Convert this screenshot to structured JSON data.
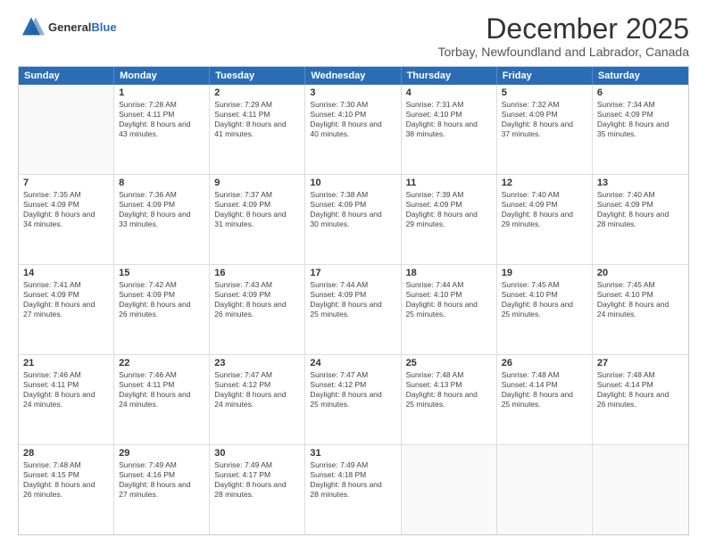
{
  "logo": {
    "line1": "General",
    "line2": "Blue"
  },
  "title": "December 2025",
  "subtitle": "Torbay, Newfoundland and Labrador, Canada",
  "header_days": [
    "Sunday",
    "Monday",
    "Tuesday",
    "Wednesday",
    "Thursday",
    "Friday",
    "Saturday"
  ],
  "weeks": [
    [
      {
        "day": "",
        "sunrise": "",
        "sunset": "",
        "daylight": ""
      },
      {
        "day": "1",
        "sunrise": "Sunrise: 7:28 AM",
        "sunset": "Sunset: 4:11 PM",
        "daylight": "Daylight: 8 hours and 43 minutes."
      },
      {
        "day": "2",
        "sunrise": "Sunrise: 7:29 AM",
        "sunset": "Sunset: 4:11 PM",
        "daylight": "Daylight: 8 hours and 41 minutes."
      },
      {
        "day": "3",
        "sunrise": "Sunrise: 7:30 AM",
        "sunset": "Sunset: 4:10 PM",
        "daylight": "Daylight: 8 hours and 40 minutes."
      },
      {
        "day": "4",
        "sunrise": "Sunrise: 7:31 AM",
        "sunset": "Sunset: 4:10 PM",
        "daylight": "Daylight: 8 hours and 38 minutes."
      },
      {
        "day": "5",
        "sunrise": "Sunrise: 7:32 AM",
        "sunset": "Sunset: 4:09 PM",
        "daylight": "Daylight: 8 hours and 37 minutes."
      },
      {
        "day": "6",
        "sunrise": "Sunrise: 7:34 AM",
        "sunset": "Sunset: 4:09 PM",
        "daylight": "Daylight: 8 hours and 35 minutes."
      }
    ],
    [
      {
        "day": "7",
        "sunrise": "Sunrise: 7:35 AM",
        "sunset": "Sunset: 4:09 PM",
        "daylight": "Daylight: 8 hours and 34 minutes."
      },
      {
        "day": "8",
        "sunrise": "Sunrise: 7:36 AM",
        "sunset": "Sunset: 4:09 PM",
        "daylight": "Daylight: 8 hours and 33 minutes."
      },
      {
        "day": "9",
        "sunrise": "Sunrise: 7:37 AM",
        "sunset": "Sunset: 4:09 PM",
        "daylight": "Daylight: 8 hours and 31 minutes."
      },
      {
        "day": "10",
        "sunrise": "Sunrise: 7:38 AM",
        "sunset": "Sunset: 4:09 PM",
        "daylight": "Daylight: 8 hours and 30 minutes."
      },
      {
        "day": "11",
        "sunrise": "Sunrise: 7:39 AM",
        "sunset": "Sunset: 4:09 PM",
        "daylight": "Daylight: 8 hours and 29 minutes."
      },
      {
        "day": "12",
        "sunrise": "Sunrise: 7:40 AM",
        "sunset": "Sunset: 4:09 PM",
        "daylight": "Daylight: 8 hours and 29 minutes."
      },
      {
        "day": "13",
        "sunrise": "Sunrise: 7:40 AM",
        "sunset": "Sunset: 4:09 PM",
        "daylight": "Daylight: 8 hours and 28 minutes."
      }
    ],
    [
      {
        "day": "14",
        "sunrise": "Sunrise: 7:41 AM",
        "sunset": "Sunset: 4:09 PM",
        "daylight": "Daylight: 8 hours and 27 minutes."
      },
      {
        "day": "15",
        "sunrise": "Sunrise: 7:42 AM",
        "sunset": "Sunset: 4:09 PM",
        "daylight": "Daylight: 8 hours and 26 minutes."
      },
      {
        "day": "16",
        "sunrise": "Sunrise: 7:43 AM",
        "sunset": "Sunset: 4:09 PM",
        "daylight": "Daylight: 8 hours and 26 minutes."
      },
      {
        "day": "17",
        "sunrise": "Sunrise: 7:44 AM",
        "sunset": "Sunset: 4:09 PM",
        "daylight": "Daylight: 8 hours and 25 minutes."
      },
      {
        "day": "18",
        "sunrise": "Sunrise: 7:44 AM",
        "sunset": "Sunset: 4:10 PM",
        "daylight": "Daylight: 8 hours and 25 minutes."
      },
      {
        "day": "19",
        "sunrise": "Sunrise: 7:45 AM",
        "sunset": "Sunset: 4:10 PM",
        "daylight": "Daylight: 8 hours and 25 minutes."
      },
      {
        "day": "20",
        "sunrise": "Sunrise: 7:45 AM",
        "sunset": "Sunset: 4:10 PM",
        "daylight": "Daylight: 8 hours and 24 minutes."
      }
    ],
    [
      {
        "day": "21",
        "sunrise": "Sunrise: 7:46 AM",
        "sunset": "Sunset: 4:11 PM",
        "daylight": "Daylight: 8 hours and 24 minutes."
      },
      {
        "day": "22",
        "sunrise": "Sunrise: 7:46 AM",
        "sunset": "Sunset: 4:11 PM",
        "daylight": "Daylight: 8 hours and 24 minutes."
      },
      {
        "day": "23",
        "sunrise": "Sunrise: 7:47 AM",
        "sunset": "Sunset: 4:12 PM",
        "daylight": "Daylight: 8 hours and 24 minutes."
      },
      {
        "day": "24",
        "sunrise": "Sunrise: 7:47 AM",
        "sunset": "Sunset: 4:12 PM",
        "daylight": "Daylight: 8 hours and 25 minutes."
      },
      {
        "day": "25",
        "sunrise": "Sunrise: 7:48 AM",
        "sunset": "Sunset: 4:13 PM",
        "daylight": "Daylight: 8 hours and 25 minutes."
      },
      {
        "day": "26",
        "sunrise": "Sunrise: 7:48 AM",
        "sunset": "Sunset: 4:14 PM",
        "daylight": "Daylight: 8 hours and 25 minutes."
      },
      {
        "day": "27",
        "sunrise": "Sunrise: 7:48 AM",
        "sunset": "Sunset: 4:14 PM",
        "daylight": "Daylight: 8 hours and 26 minutes."
      }
    ],
    [
      {
        "day": "28",
        "sunrise": "Sunrise: 7:48 AM",
        "sunset": "Sunset: 4:15 PM",
        "daylight": "Daylight: 8 hours and 26 minutes."
      },
      {
        "day": "29",
        "sunrise": "Sunrise: 7:49 AM",
        "sunset": "Sunset: 4:16 PM",
        "daylight": "Daylight: 8 hours and 27 minutes."
      },
      {
        "day": "30",
        "sunrise": "Sunrise: 7:49 AM",
        "sunset": "Sunset: 4:17 PM",
        "daylight": "Daylight: 8 hours and 28 minutes."
      },
      {
        "day": "31",
        "sunrise": "Sunrise: 7:49 AM",
        "sunset": "Sunset: 4:18 PM",
        "daylight": "Daylight: 8 hours and 28 minutes."
      },
      {
        "day": "",
        "sunrise": "",
        "sunset": "",
        "daylight": ""
      },
      {
        "day": "",
        "sunrise": "",
        "sunset": "",
        "daylight": ""
      },
      {
        "day": "",
        "sunrise": "",
        "sunset": "",
        "daylight": ""
      }
    ]
  ]
}
